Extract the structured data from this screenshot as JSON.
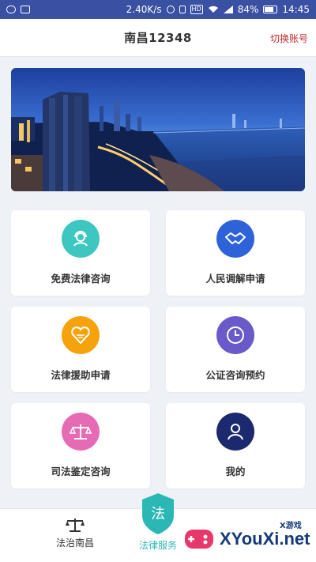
{
  "status_bar": {
    "speed": "2.40K/s",
    "hd": "HD",
    "battery": "84%",
    "time": "14:45"
  },
  "header": {
    "title": "南昌12348",
    "switch_account": "切换账号"
  },
  "services": [
    {
      "label": "免费法律咨询",
      "icon": "headset-consult-icon",
      "color": "#3ec7c0"
    },
    {
      "label": "人民调解申请",
      "icon": "handshake-icon",
      "color": "#2d62d8"
    },
    {
      "label": "法律援助申请",
      "icon": "heart-emblem-icon",
      "color": "#f5a20c"
    },
    {
      "label": "公证咨询预约",
      "icon": "clock-icon",
      "color": "#6959c9"
    },
    {
      "label": "司法鉴定咨询",
      "icon": "scales-icon",
      "color": "#e56bb4"
    },
    {
      "label": "我的",
      "icon": "user-icon",
      "color": "#1b2a6e"
    }
  ],
  "bottom_nav": [
    {
      "label": "法治南昌",
      "icon": "scales-icon",
      "color": "#333333"
    },
    {
      "label": "法律服务",
      "icon": "law-shield-icon",
      "color": "#2bb8b5",
      "badge_char": "法"
    }
  ],
  "watermark": {
    "text": "XYouXi.net",
    "small": "X游戏"
  }
}
